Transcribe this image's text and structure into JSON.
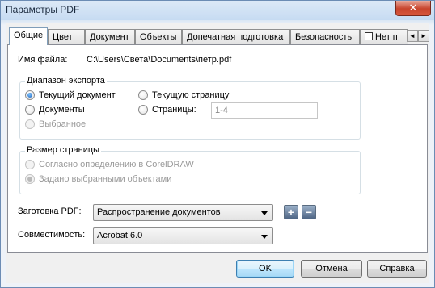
{
  "window": {
    "title": "Параметры PDF",
    "close_glyph": "✕"
  },
  "tabs": [
    {
      "label": "Общие",
      "active": true
    },
    {
      "label": "Цвет"
    },
    {
      "label": "Документ"
    },
    {
      "label": "Объекты"
    },
    {
      "label": "Допечатная подготовка"
    },
    {
      "label": "Безопасность"
    },
    {
      "label": "Нет п"
    }
  ],
  "tab_scroll": {
    "left": "◄",
    "right": "►"
  },
  "file": {
    "label": "Имя файла:",
    "path": "C:\\Users\\Света\\Documents\\петр.pdf"
  },
  "export_range": {
    "title": "Диапазон экспорта",
    "current_document": "Текущий документ",
    "documents": "Документы",
    "selection": "Выбранное",
    "current_page": "Текущую страницу",
    "pages": "Страницы:",
    "pages_value": "1-4"
  },
  "page_size": {
    "title": "Размер страницы",
    "as_in_coreldraw": "Согласно определению в CorelDRAW",
    "by_selected_objects": "Задано выбранными объектами"
  },
  "preset": {
    "label": "Заготовка PDF:",
    "value": "Распространение документов",
    "add": "+",
    "remove": "−"
  },
  "compatibility": {
    "label": "Совместимость:",
    "value": "Acrobat 6.0"
  },
  "buttons": {
    "ok": "OK",
    "cancel": "Отмена",
    "help": "Справка"
  }
}
